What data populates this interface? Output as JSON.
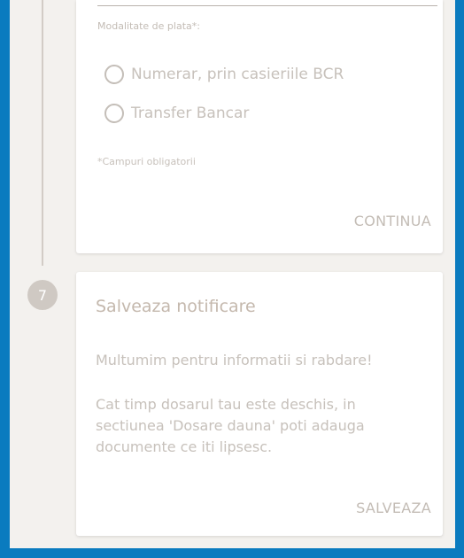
{
  "colors": {
    "frame_border": "#0a7bbf",
    "background": "#f3f1ee",
    "muted_text": "#c7c1bb",
    "badge": "#cfc9c3"
  },
  "payment_card": {
    "field_label": "Modalitate de plata*:",
    "options": [
      {
        "label": "Numerar, prin casieriile BCR",
        "selected": false,
        "icon": "radio-unchecked-icon"
      },
      {
        "label": "Transfer Bancar",
        "selected": false,
        "icon": "radio-unchecked-icon"
      }
    ],
    "required_note": "*Campuri obligatorii",
    "continue_label": "CONTINUA"
  },
  "step7": {
    "number": "7",
    "title": "Salveaza notificare",
    "message1": "Multumim pentru informatii si rabdare!",
    "message2": "Cat timp dosarul tau este deschis, in sectiunea 'Dosare dauna' poti adauga documente ce iti lipsesc.",
    "save_label": "SALVEAZA"
  }
}
